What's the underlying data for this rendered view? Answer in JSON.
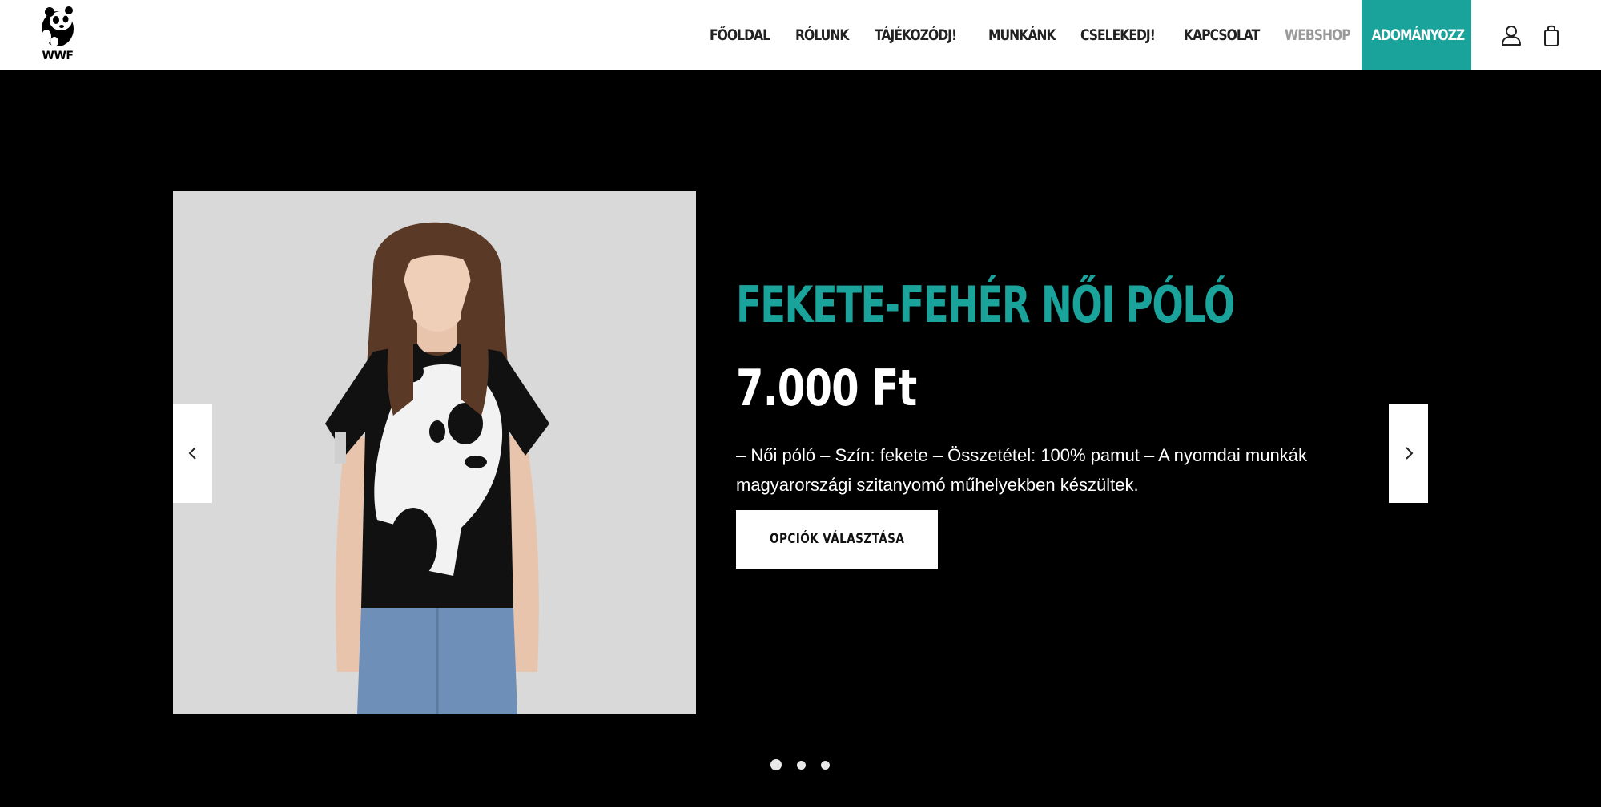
{
  "header": {
    "logo_text": "WWF",
    "nav": [
      {
        "label": "FŐOLDAL"
      },
      {
        "label": "RÓLUNK"
      },
      {
        "label": "TÁJÉKOZÓDJ!"
      },
      {
        "label": "MUNKÁNK"
      },
      {
        "label": "CSELEKEDJ!"
      },
      {
        "label": "KAPCSOLAT"
      },
      {
        "label": "WEBSHOP"
      }
    ],
    "donate_label": "ADOMÁNYOZZ",
    "icons": [
      "user-icon",
      "shopping-bag-icon"
    ]
  },
  "slider": {
    "product_title": "FEKETE-FEHÉR NŐI PÓLÓ",
    "price": "7.000 Ft",
    "description": "– Női póló – Szín: fekete – Összetétel: 100%  pamut – A nyomdai munkák magyarországi szitanyomó műhelyekben készültek.",
    "button_label": "OPCIÓK VÁLASZTÁSA",
    "dots": 3,
    "active_dot": 0
  },
  "colors": {
    "accent": "#1aa39b",
    "hero_bg": "#000000",
    "muted_nav": "#9a9a9a"
  }
}
